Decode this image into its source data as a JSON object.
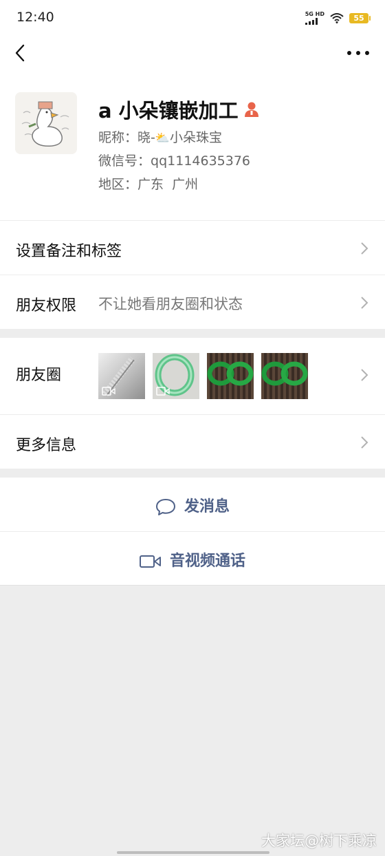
{
  "status": {
    "time": "12:40",
    "network": "5G HD",
    "battery": "55"
  },
  "profile": {
    "name": "a 小朵镶嵌加工",
    "nickname_label": "昵称：",
    "nickname_value_prefix": "晓-",
    "nickname_value_suffix": "小朵珠宝",
    "wechat_label": "微信号：",
    "wechat_value": "qq1114635376",
    "region_label": "地区：",
    "region_value": "广东  广州"
  },
  "rows": {
    "remark": "设置备注和标签",
    "permission_label": "朋友权限",
    "permission_value": "不让她看朋友圈和状态",
    "moments": "朋友圈",
    "more_info": "更多信息"
  },
  "actions": {
    "message": "发消息",
    "call": "音视频通话"
  },
  "watermark": "大家坛@树下乘凉",
  "icons": {
    "back": "chevron-left-icon",
    "more": "more-dots-icon",
    "badge": "person-badge-icon"
  },
  "colors": {
    "action_text": "#4f6188",
    "badge": "#e8644a",
    "battery": "#e8b923"
  }
}
